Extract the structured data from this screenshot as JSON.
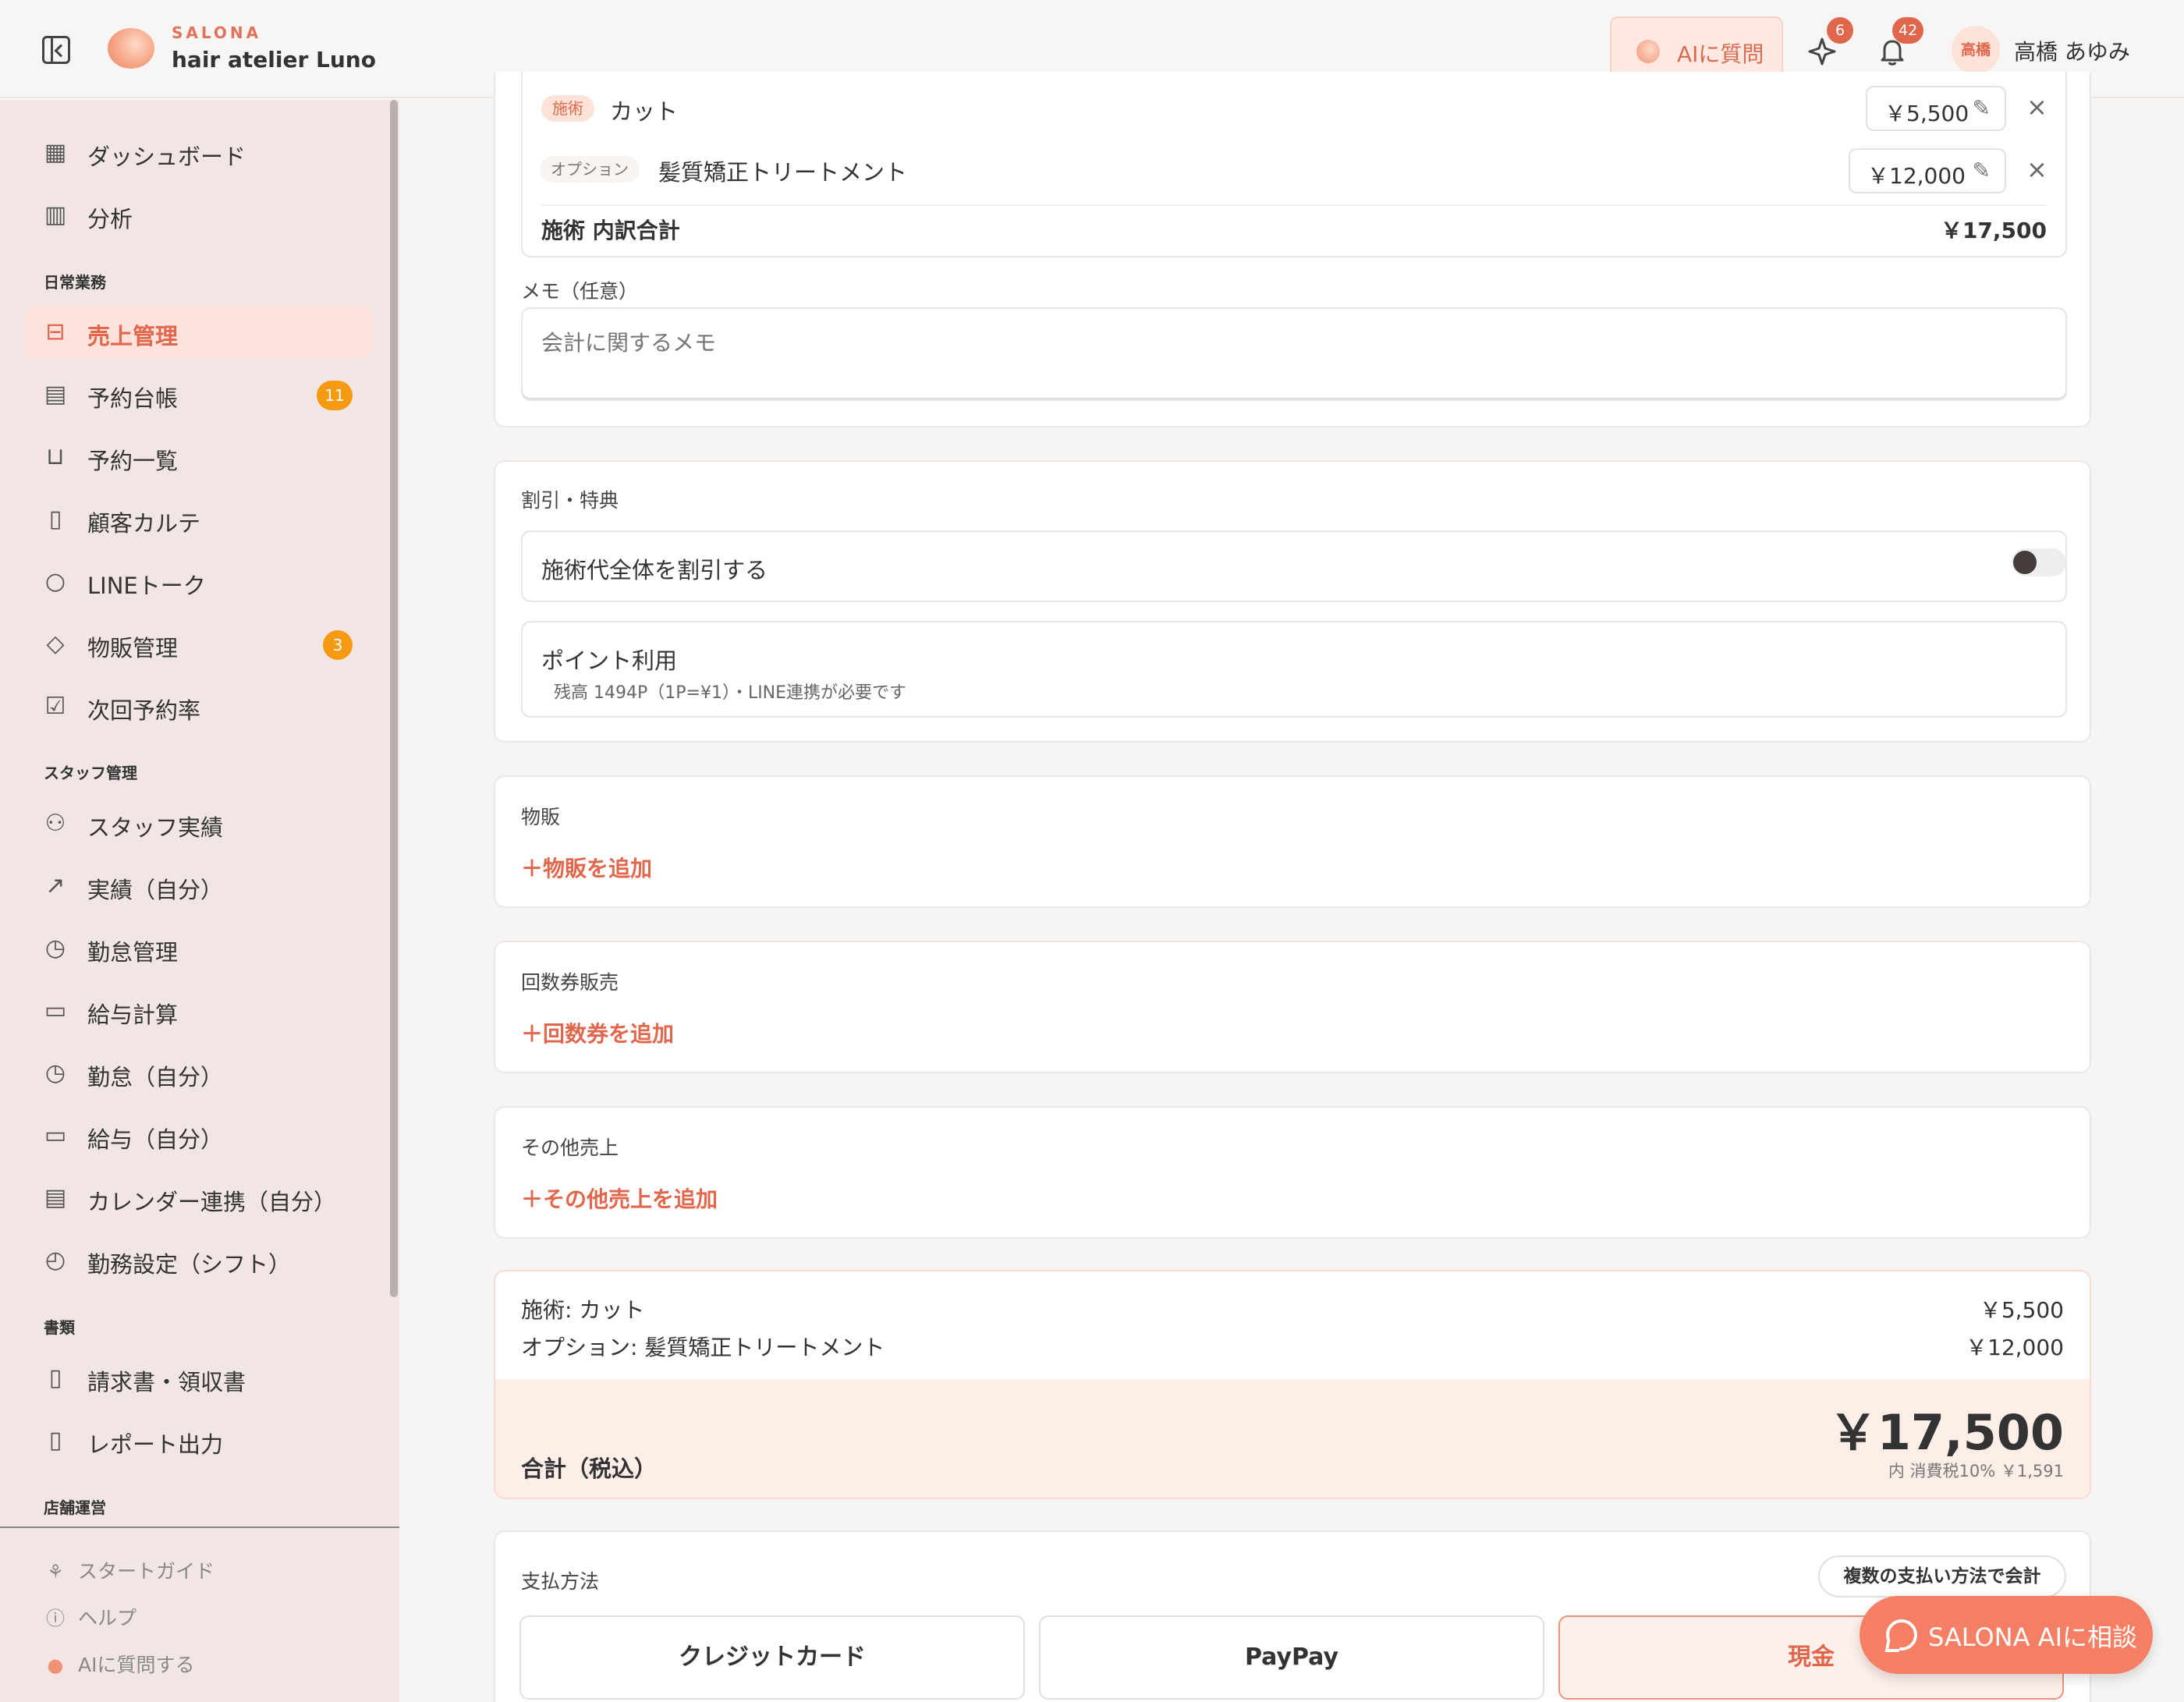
{
  "header": {
    "brand": "SALONA",
    "salon_name": "hair atelier Luno",
    "ai_button": "AIに質問",
    "sparkle_count": "6",
    "notif_count": "42",
    "avatar_text": "高橋",
    "user_name": "高橋 あゆみ"
  },
  "sidebar": {
    "top_items": [
      {
        "label": "ダッシュボード",
        "icon": "grid-icon"
      },
      {
        "label": "分析",
        "icon": "bar-chart-icon"
      }
    ],
    "section_daily": "日常業務",
    "daily_items": [
      {
        "label": "売上管理",
        "icon": "receipt-icon",
        "active": true
      },
      {
        "label": "予約台帳",
        "icon": "calendar-icon",
        "badge": "11"
      },
      {
        "label": "予約一覧",
        "icon": "inbox-icon"
      },
      {
        "label": "顧客カルテ",
        "icon": "clipboard-icon"
      },
      {
        "label": "LINEトーク",
        "icon": "chat-icon"
      },
      {
        "label": "物販管理",
        "icon": "box-icon",
        "badge": "3"
      },
      {
        "label": "次回予約率",
        "icon": "calendar-check-icon"
      }
    ],
    "section_staff": "スタッフ管理",
    "staff_items": [
      {
        "label": "スタッフ実績",
        "icon": "users-icon"
      },
      {
        "label": "実績（自分）",
        "icon": "trend-icon"
      },
      {
        "label": "勤怠管理",
        "icon": "clock-icon"
      },
      {
        "label": "給与計算",
        "icon": "wallet-icon"
      },
      {
        "label": "勤怠（自分）",
        "icon": "clock-icon"
      },
      {
        "label": "給与（自分）",
        "icon": "wallet-icon"
      },
      {
        "label": "カレンダー連携（自分）",
        "icon": "calendar-icon"
      },
      {
        "label": "勤務設定（シフト）",
        "icon": "calendar-clock-icon"
      }
    ],
    "section_docs": "書類",
    "doc_items": [
      {
        "label": "請求書・領収書",
        "icon": "file-check-icon"
      },
      {
        "label": "レポート出力",
        "icon": "file-icon"
      }
    ],
    "section_store": "店舗運営",
    "footer": {
      "start_guide": "スタートガイド",
      "help": "ヘルプ",
      "ask_ai": "AIに質問する"
    }
  },
  "treatment": {
    "item1_tag": "施術",
    "item1_name": "カット",
    "item1_price": "￥5,500",
    "item2_tag": "オプション",
    "item2_name": "髪質矯正トリートメント",
    "item2_price": "￥12,000",
    "subtotal_label": "施術 内訳合計",
    "subtotal_value": "￥17,500",
    "memo_label": "メモ（任意）",
    "memo_placeholder": "会計に関するメモ"
  },
  "discount": {
    "title": "割引・特典",
    "whole_discount": "施術代全体を割引する",
    "whole_discount_on": false,
    "points_title": "ポイント利用",
    "points_sub": "残高 1494P（1P=¥1）・LINE連携が必要です"
  },
  "retail": {
    "title": "物販",
    "add": "物販を追加"
  },
  "ticket": {
    "title": "回数券販売",
    "add": "回数券を追加"
  },
  "other": {
    "title": "その他売上",
    "add": "その他売上を追加"
  },
  "summary": {
    "line1_label": "施術: カット",
    "line1_value": "￥5,500",
    "line2_label": "オプション: 髪質矯正トリートメント",
    "line2_value": "￥12,000",
    "total_label": "合計（税込）",
    "total_value": "￥17,500",
    "tax_note": "内 消費税10% ￥1,591"
  },
  "payment": {
    "title": "支払方法",
    "split_button": "複数の支払い方法で会計",
    "methods": [
      "クレジットカード",
      "PayPay",
      "現金"
    ],
    "selected": "現金"
  },
  "fab": {
    "label": "SALONA AIに相談"
  },
  "colors": {
    "accent": "#e0664c",
    "badge": "#f59a12",
    "sidebar_bg": "#f1e6e3"
  }
}
